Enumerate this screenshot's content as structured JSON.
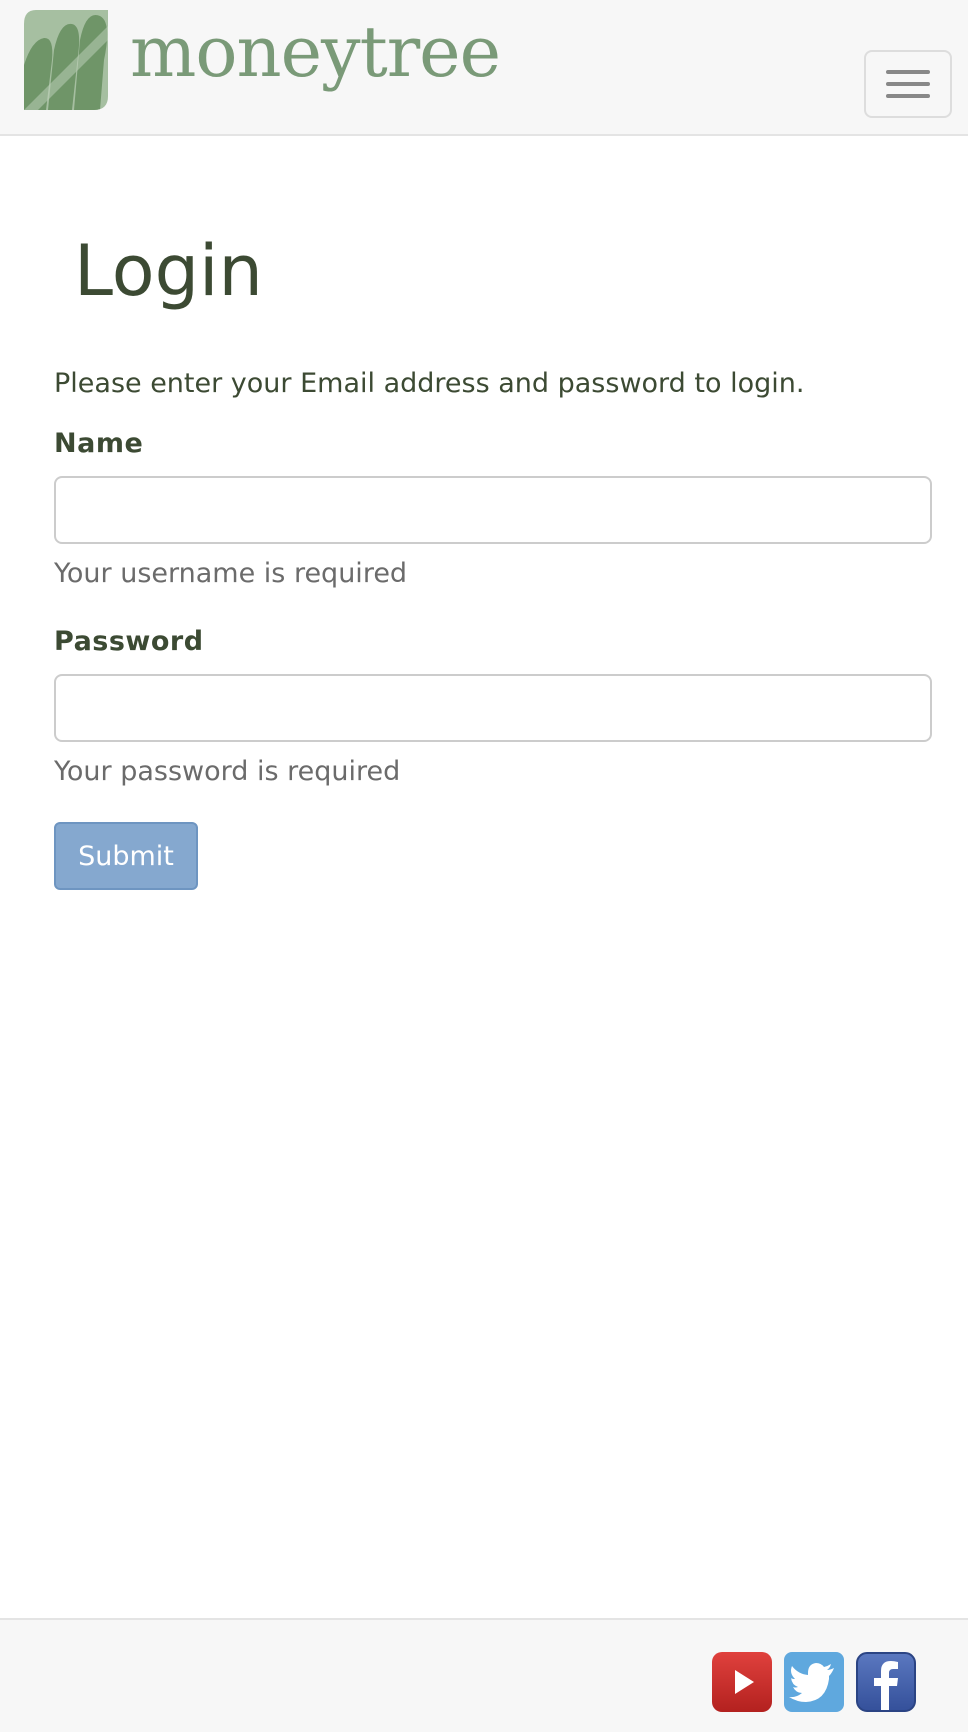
{
  "header": {
    "brand_name": "moneytree",
    "menu_icon": "hamburger-menu-icon"
  },
  "login": {
    "title": "Login",
    "intro": "Please enter your Email address and password to login.",
    "name_label": "Name",
    "name_value": "",
    "name_help": "Your username is required",
    "password_label": "Password",
    "password_value": "",
    "password_help": "Your password is required",
    "submit_label": "Submit"
  },
  "footer": {
    "social": [
      {
        "icon": "youtube-icon"
      },
      {
        "icon": "twitter-icon"
      },
      {
        "icon": "facebook-icon"
      }
    ]
  },
  "colors": {
    "brand_green": "#7a9a78",
    "text_dark": "#3c4a33",
    "submit_blue": "#85a8cf"
  }
}
